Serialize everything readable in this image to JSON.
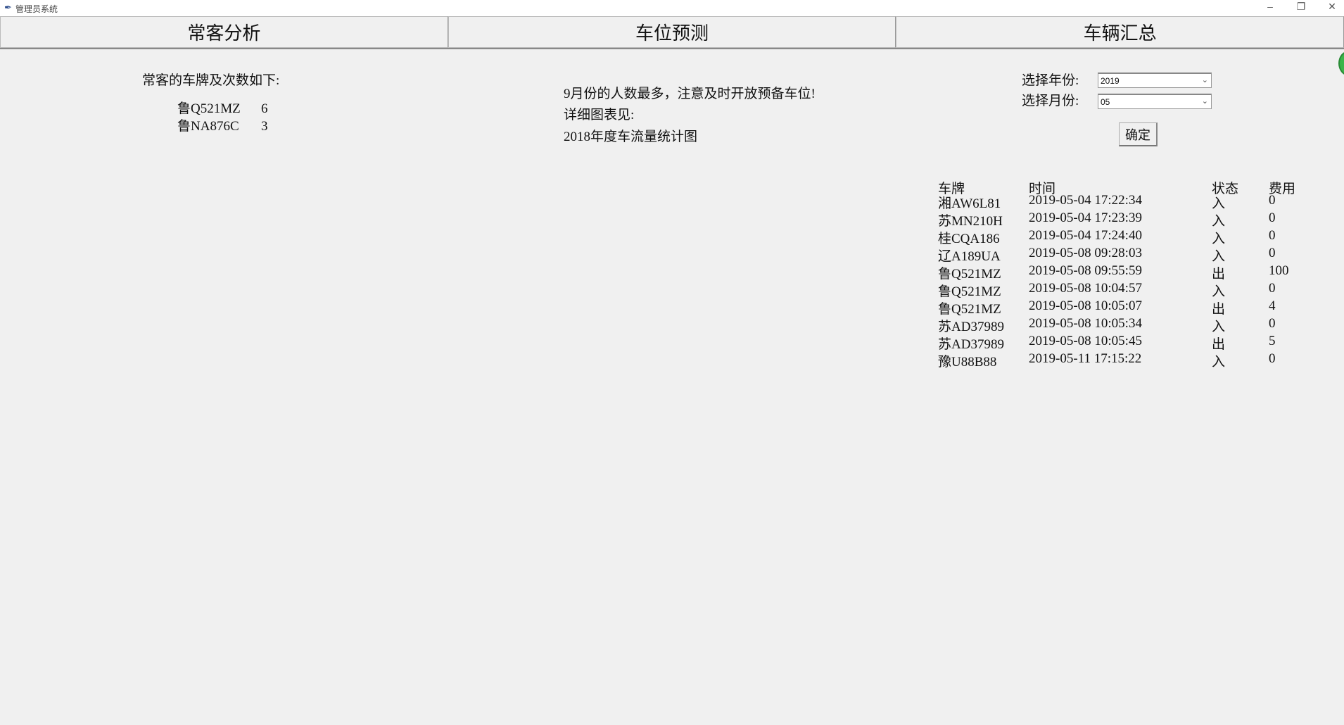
{
  "window": {
    "title": "管理员系统",
    "icon": "feather-icon",
    "controls": [
      "minimize",
      "restore",
      "close"
    ]
  },
  "tabs": [
    {
      "label": "常客分析"
    },
    {
      "label": "车位预测"
    },
    {
      "label": "车辆汇总"
    }
  ],
  "frequent": {
    "heading": "常客的车牌及次数如下:",
    "items": [
      {
        "plate": "鲁Q521MZ",
        "count": "6"
      },
      {
        "plate": "鲁NA876C",
        "count": "3"
      }
    ]
  },
  "prediction": {
    "lines": [
      "9月份的人数最多，注意及时开放预备车位!",
      "详细图表见:",
      "2018年度车流量统计图"
    ]
  },
  "summary": {
    "year_label": "选择年份:",
    "year_value": "2019",
    "month_label": "选择月份:",
    "month_value": "05",
    "confirm_label": "确定",
    "columns": [
      "车牌",
      "时间",
      "状态",
      "费用"
    ],
    "rows": [
      [
        "湘AW6L81",
        "2019-05-04 17:22:34",
        "入",
        "0"
      ],
      [
        "苏MN210H",
        "2019-05-04 17:23:39",
        "入",
        "0"
      ],
      [
        "桂CQA186",
        "2019-05-04 17:24:40",
        "入",
        "0"
      ],
      [
        "辽A189UA",
        "2019-05-08 09:28:03",
        "入",
        "0"
      ],
      [
        "鲁Q521MZ",
        "2019-05-08 09:55:59",
        "出",
        "100"
      ],
      [
        "鲁Q521MZ",
        "2019-05-08 10:04:57",
        "入",
        "0"
      ],
      [
        "鲁Q521MZ",
        "2019-05-08 10:05:07",
        "出",
        "4"
      ],
      [
        "苏AD37989",
        "2019-05-08 10:05:34",
        "入",
        "0"
      ],
      [
        "苏AD37989",
        "2019-05-08 10:05:45",
        "出",
        "5"
      ],
      [
        "豫U88B88",
        "2019-05-11 17:15:22",
        "入",
        "0"
      ]
    ]
  }
}
